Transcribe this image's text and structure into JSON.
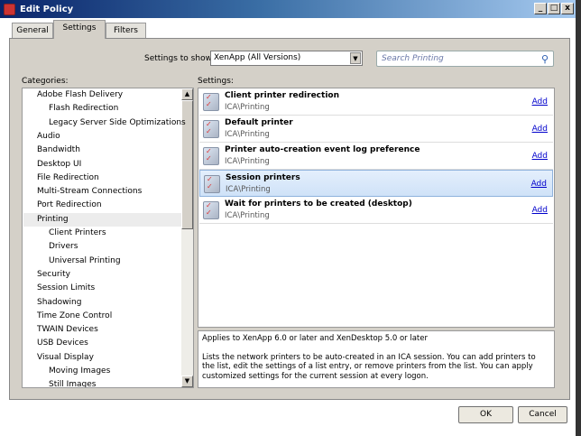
{
  "window": {
    "title": "Edit Policy",
    "minimize": "_",
    "maximize": "□",
    "close": "x"
  },
  "tabs": [
    "General",
    "Settings",
    "Filters"
  ],
  "filter": {
    "label": "Settings to show:",
    "value": "XenApp (All Versions)",
    "search_placeholder": "Search Printing"
  },
  "categories": {
    "label": "Categories:",
    "items": [
      {
        "label": "Adobe Flash Delivery",
        "level": 0
      },
      {
        "label": "Flash Redirection",
        "level": 1
      },
      {
        "label": "Legacy Server Side Optimizations",
        "level": 1
      },
      {
        "label": "Audio",
        "level": 0
      },
      {
        "label": "Bandwidth",
        "level": 0
      },
      {
        "label": "Desktop UI",
        "level": 0
      },
      {
        "label": "File Redirection",
        "level": 0
      },
      {
        "label": "Multi-Stream Connections",
        "level": 0
      },
      {
        "label": "Port Redirection",
        "level": 0
      },
      {
        "label": "Printing",
        "level": 0,
        "selected": true
      },
      {
        "label": "Client Printers",
        "level": 1
      },
      {
        "label": "Drivers",
        "level": 1
      },
      {
        "label": "Universal Printing",
        "level": 1
      },
      {
        "label": "Security",
        "level": 0
      },
      {
        "label": "Session Limits",
        "level": 0
      },
      {
        "label": "Shadowing",
        "level": 0
      },
      {
        "label": "Time Zone Control",
        "level": 0
      },
      {
        "label": "TWAIN Devices",
        "level": 0
      },
      {
        "label": "USB Devices",
        "level": 0
      },
      {
        "label": "Visual Display",
        "level": 0
      },
      {
        "label": "Moving Images",
        "level": 1
      },
      {
        "label": "Still Images",
        "level": 1
      }
    ]
  },
  "settings": {
    "label": "Settings:",
    "rows": [
      {
        "name": "Client printer redirection",
        "path": "ICA\\Printing",
        "action": "Add"
      },
      {
        "name": "Default printer",
        "path": "ICA\\Printing",
        "action": "Add"
      },
      {
        "name": "Printer auto-creation event log preference",
        "path": "ICA\\Printing",
        "action": "Add"
      },
      {
        "name": "Session printers",
        "path": "ICA\\Printing",
        "action": "Add",
        "selected": true
      },
      {
        "name": "Wait for printers to be created (desktop)",
        "path": "ICA\\Printing",
        "action": "Add"
      }
    ]
  },
  "description": {
    "applies": "Applies to XenApp 6.0 or later and XenDesktop 5.0 or later",
    "text": "Lists the network printers to be auto-created in an ICA session.  You can add printers to the list, edit the settings of a list entry, or remove printers from the list. You can apply customized settings for the current session at every logon."
  },
  "buttons": {
    "ok": "OK",
    "cancel": "Cancel"
  }
}
